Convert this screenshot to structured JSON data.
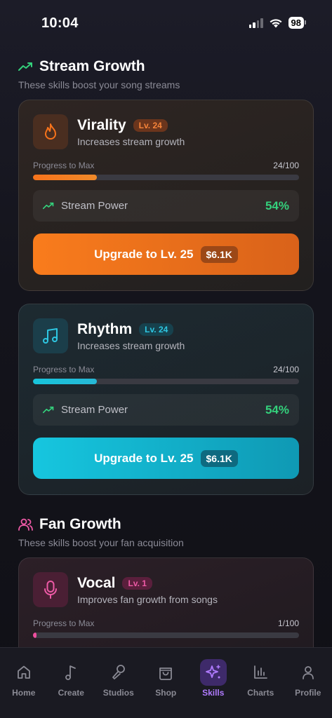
{
  "status": {
    "time": "10:04",
    "battery": "98"
  },
  "sections": [
    {
      "title": "Stream Growth",
      "subtitle": "These skills boost your song streams",
      "icon": "trending-up-icon",
      "skills": [
        {
          "name": "Virality",
          "level": "Lv. 24",
          "description": "Increases stream growth",
          "progress_label": "Progress to Max",
          "progress_value": "24/100",
          "progress": 0.24,
          "power_label": "Stream Power",
          "power_value": "54%",
          "upgrade_label": "Upgrade to Lv. 25",
          "price": "$6.1K",
          "icon": "flame-icon",
          "accent": "#f7731b"
        },
        {
          "name": "Rhythm",
          "level": "Lv. 24",
          "description": "Increases stream growth",
          "progress_label": "Progress to Max",
          "progress_value": "24/100",
          "progress": 0.24,
          "power_label": "Stream Power",
          "power_value": "54%",
          "upgrade_label": "Upgrade to Lv. 25",
          "price": "$6.1K",
          "icon": "music-note-icon",
          "accent": "#17c4db"
        }
      ]
    },
    {
      "title": "Fan Growth",
      "subtitle": "These skills boost your fan acquisition",
      "icon": "users-icon",
      "skills": [
        {
          "name": "Vocal",
          "level": "Lv. 1",
          "description": "Improves fan growth from songs",
          "progress_label": "Progress to Max",
          "progress_value": "1/100",
          "progress": 0.01,
          "icon": "microphone-icon",
          "accent": "#ee4f9e"
        }
      ]
    }
  ],
  "tabs": [
    {
      "label": "Home",
      "icon": "home-icon"
    },
    {
      "label": "Create",
      "icon": "music-note-icon"
    },
    {
      "label": "Studios",
      "icon": "microphone-icon"
    },
    {
      "label": "Shop",
      "icon": "shopping-bag-icon"
    },
    {
      "label": "Skills",
      "icon": "sparkles-icon",
      "active": true
    },
    {
      "label": "Charts",
      "icon": "bar-chart-icon"
    },
    {
      "label": "Profile",
      "icon": "user-icon"
    }
  ]
}
